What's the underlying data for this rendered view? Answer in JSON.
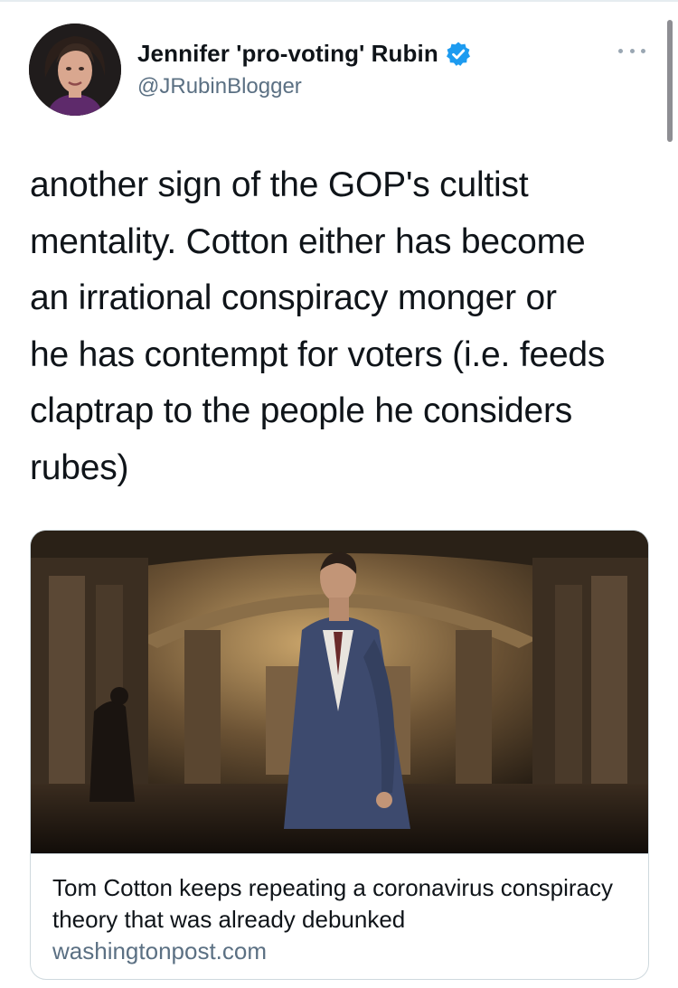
{
  "author": {
    "display_name": "Jennifer 'pro-voting' Rubin",
    "handle": "@JRubinBlogger",
    "verified": true
  },
  "tweet": {
    "text": "another sign of the GOP's cultist\nmentality. Cotton either has become\nan irrational conspiracy monger or\nhe has contempt for voters (i.e. feeds\nclaptrap to the people he considers\nrubes)"
  },
  "link_card": {
    "title": "Tom Cotton keeps repeating a coronavirus conspiracy theory that was already debunked",
    "domain": "washingtonpost.com"
  },
  "icons": {
    "verified": "verified-badge-icon",
    "more": "more-options-icon"
  },
  "colors": {
    "verified_blue": "#1d9bf0",
    "secondary_text": "#5b7083",
    "border": "#cfd9de"
  }
}
